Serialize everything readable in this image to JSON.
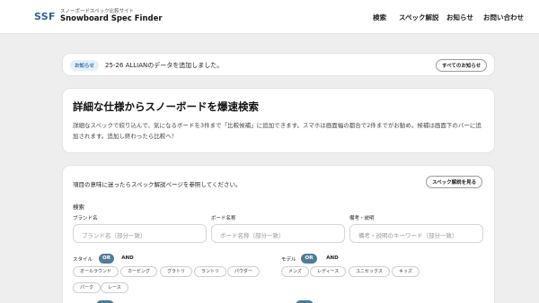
{
  "header": {
    "logo": "SSF",
    "subtitle": "スノーボードスペック比較サイト",
    "title": "Snowboard Spec Finder",
    "nav": [
      "検索",
      "スペック解説",
      "お知らせ",
      "お問い合わせ"
    ]
  },
  "notice": {
    "badge": "お知らせ",
    "text": "25-26 ALLIANのデータを追加しました。",
    "all_button": "すべてのお知らせ"
  },
  "hero": {
    "title": "詳細な仕様からスノーボードを爆速検索",
    "description": "詳細なスペックで絞り込んで、気になるボードを3件まで「比較候補」に追加できます。スマホは画面幅の都合で2件までがお勧め。候補は画面下のバーに追加されます。追加し終わったら比較へ！"
  },
  "search": {
    "hint": "項目の意味に迷ったらスペック解説ページを参照してください。",
    "spec_button": "スペック解説を見る",
    "section_title": "検索",
    "fields": [
      {
        "label": "ブランド名",
        "placeholder": "ブランド名（部分一致）"
      },
      {
        "label": "ボード名称",
        "placeholder": "ボード名称（部分一致）"
      },
      {
        "label": "備考・説明",
        "placeholder": "備考・説明のキーワード（部分一致）"
      }
    ],
    "style": {
      "label": "スタイル",
      "or": "OR",
      "and": "AND",
      "options": [
        "オールラウンド",
        "カービング",
        "グラトリ",
        "ラントリ",
        "パウダー",
        "パーク",
        "レース"
      ]
    },
    "model": {
      "label": "モデル",
      "or": "OR",
      "and": "AND",
      "options": [
        "メンズ",
        "レディース",
        "ユニセックス",
        "キッズ"
      ]
    }
  },
  "colors": {
    "accent": "#4f7c99",
    "logo": "#2f5f9e",
    "badge_bg": "#e3f0f9",
    "badge_text": "#2c6f9f",
    "page_bg": "#eeeeee"
  }
}
